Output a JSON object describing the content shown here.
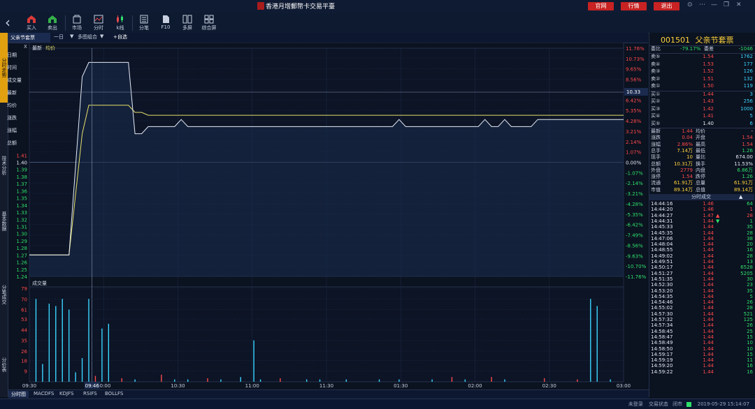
{
  "app": {
    "title": "香港月增郵幣卡交易平臺",
    "top_buttons": [
      "官网",
      "行情",
      "退出"
    ],
    "window_controls": [
      "⊙",
      "⋯",
      "—",
      "❐",
      "✕"
    ]
  },
  "toolbar": {
    "items": [
      {
        "label": "买入",
        "icon": "buy-icon"
      },
      {
        "label": "卖出",
        "icon": "sell-icon"
      },
      {
        "label": "市场",
        "icon": "market-icon"
      },
      {
        "label": "分时",
        "icon": "timeshare-icon"
      },
      {
        "label": "k线",
        "icon": "kline-icon"
      },
      {
        "label": "分笔",
        "icon": "ticks-icon"
      },
      {
        "label": "F10",
        "icon": "f10-icon"
      },
      {
        "label": "多屏",
        "icon": "multiscreen-icon"
      },
      {
        "label": "综合屏",
        "icon": "composite-icon"
      }
    ]
  },
  "left_rail": {
    "tabs": [
      "分时走势",
      "技术分析",
      "基本数据",
      "分笔成交",
      "分价表"
    ]
  },
  "chart_header": {
    "stock": "父亲节套票",
    "period": "一日",
    "period_arrow": "▼",
    "mode": "多图组合",
    "mode_arrow": "▼",
    "add_fav": "+自选",
    "close": "X",
    "legend_latest": "最新",
    "legend_avg": "均价",
    "volume_label": "成交量",
    "crosshair_value": "10.33",
    "crosshair_time": "09:46"
  },
  "overlay_menu": [
    "日期",
    "时间",
    "成交量",
    "最新",
    "均价",
    "涨跌",
    "涨幅",
    "总额"
  ],
  "colors": {
    "price_line": "#e6ebf5",
    "avg_line": "#e8e06a",
    "up": "#ff4a4a",
    "down": "#2ee06a",
    "accent": "#ffd23c",
    "volume_up": "#ff4a4a",
    "volume_down": "#3ad6ff"
  },
  "chart_data": {
    "type": "line",
    "x_ticks": [
      "09:30",
      "10:00",
      "10:30",
      "11:00",
      "11:30",
      "01:30",
      "02:00",
      "02:30",
      "03:00"
    ],
    "y_left_ticks": [
      "1.41",
      "1.40",
      "1.39",
      "1.38",
      "1.37",
      "1.36",
      "1.35",
      "1.34",
      "1.33",
      "1.32",
      "1.31",
      "1.30",
      "1.29",
      "1.28",
      "1.27",
      "1.26",
      "1.25",
      "1.24"
    ],
    "y_right_ticks": [
      "11.76%",
      "10.73%",
      "9.65%",
      "8.56%",
      "7.49%",
      "6.42%",
      "5.35%",
      "4.28%",
      "3.21%",
      "2.14%",
      "1.07%",
      "0.00%",
      "-1.07%",
      "-2.14%",
      "-3.21%",
      "-4.28%",
      "-5.35%",
      "-6.42%",
      "-7.49%",
      "-8.56%",
      "-9.63%",
      "-10.70%",
      "-11.76%"
    ],
    "ylim": [
      1.24,
      1.56
    ],
    "prev_close": 1.4,
    "volume_ticks": [
      "79",
      "70",
      "61",
      "53",
      "44",
      "35",
      "26",
      "18",
      "9"
    ],
    "volume_ylim": [
      0,
      79
    ],
    "series": [
      {
        "name": "最新",
        "points": [
          [
            0,
            1.27
          ],
          [
            6,
            1.27
          ],
          [
            8,
            1.52
          ],
          [
            9,
            1.54
          ],
          [
            15,
            1.54
          ],
          [
            16,
            1.44
          ],
          [
            17,
            1.44
          ],
          [
            18,
            1.45
          ],
          [
            22,
            1.45
          ],
          [
            23,
            1.46
          ],
          [
            24,
            1.45
          ],
          [
            55,
            1.45
          ],
          [
            56,
            1.46
          ],
          [
            57,
            1.45
          ],
          [
            68,
            1.45
          ],
          [
            69,
            1.46
          ],
          [
            70,
            1.45
          ],
          [
            71,
            1.45
          ],
          [
            72,
            1.46
          ],
          [
            73,
            1.45
          ],
          [
            76,
            1.45
          ],
          [
            77,
            1.46
          ],
          [
            90,
            1.46
          ]
        ]
      },
      {
        "name": "均价",
        "points": [
          [
            0,
            1.27
          ],
          [
            6,
            1.27
          ],
          [
            8,
            1.44
          ],
          [
            9,
            1.48
          ],
          [
            15,
            1.48
          ],
          [
            16,
            1.47
          ],
          [
            17,
            1.47
          ],
          [
            18,
            1.466
          ],
          [
            90,
            1.466
          ]
        ]
      }
    ],
    "volume_bars": [
      [
        1,
        70,
        "d"
      ],
      [
        2,
        15,
        "d"
      ],
      [
        3,
        66,
        "d"
      ],
      [
        4,
        64,
        "d"
      ],
      [
        5,
        70,
        "d"
      ],
      [
        6,
        61,
        "d"
      ],
      [
        7,
        8,
        "d"
      ],
      [
        8,
        20,
        "d"
      ],
      [
        9,
        70,
        "d"
      ],
      [
        10,
        5,
        "u"
      ],
      [
        11,
        45,
        "d"
      ],
      [
        12,
        49,
        "d"
      ],
      [
        14,
        3,
        "u"
      ],
      [
        16,
        2,
        "d"
      ],
      [
        20,
        6,
        "u"
      ],
      [
        22,
        2,
        "d"
      ],
      [
        24,
        2,
        "d"
      ],
      [
        27,
        3,
        "u"
      ],
      [
        29,
        2,
        "d"
      ],
      [
        32,
        4,
        "d"
      ],
      [
        34,
        35,
        "d"
      ],
      [
        35,
        2,
        "d"
      ],
      [
        38,
        3,
        "u"
      ],
      [
        42,
        2,
        "d"
      ],
      [
        44,
        2,
        "d"
      ],
      [
        48,
        2,
        "d"
      ],
      [
        53,
        2,
        "d"
      ],
      [
        56,
        2,
        "d"
      ],
      [
        61,
        2,
        "d"
      ],
      [
        64,
        4,
        "u"
      ],
      [
        66,
        2,
        "d"
      ],
      [
        70,
        4,
        "u"
      ],
      [
        72,
        2,
        "d"
      ],
      [
        78,
        3,
        "u"
      ],
      [
        83,
        2,
        "u"
      ],
      [
        85,
        70,
        "d"
      ],
      [
        86,
        64,
        "d"
      ],
      [
        88,
        2,
        "d"
      ]
    ]
  },
  "right_panel": {
    "code": "001501",
    "name": "父亲节套票",
    "ratio_row": {
      "label": "委比",
      "value": "-79.17%",
      "label2": "委差",
      "value2": "-1046"
    },
    "asks": [
      {
        "label": "卖⑤",
        "price": "1.54",
        "vol": "1762"
      },
      {
        "label": "卖④",
        "price": "1.53",
        "vol": "177"
      },
      {
        "label": "卖③",
        "price": "1.52",
        "vol": "126"
      },
      {
        "label": "卖②",
        "price": "1.51",
        "vol": "132"
      },
      {
        "label": "卖①",
        "price": "1.50",
        "vol": "119"
      }
    ],
    "bids": [
      {
        "label": "买①",
        "price": "1.44",
        "vol": "3",
        "pcolor": "r"
      },
      {
        "label": "买②",
        "price": "1.43",
        "vol": "256",
        "pcolor": "r"
      },
      {
        "label": "买③",
        "price": "1.42",
        "vol": "1000",
        "pcolor": "r"
      },
      {
        "label": "买④",
        "price": "1.41",
        "vol": "5",
        "pcolor": "r"
      },
      {
        "label": "买⑤",
        "price": "1.40",
        "vol": "6",
        "pcolor": "w"
      }
    ],
    "stats": [
      {
        "l1": "最新",
        "v1": "1.44",
        "c1": "r",
        "l2": "均价",
        "v2": "-",
        "c2": "w"
      },
      {
        "l1": "涨跌",
        "v1": "0.04",
        "c1": "r",
        "l2": "开盘",
        "v2": "1.54",
        "c2": "r"
      },
      {
        "l1": "涨幅",
        "v1": "2.86%",
        "c1": "r",
        "l2": "最高",
        "v2": "1.54",
        "c2": "r"
      },
      {
        "l1": "总手",
        "v1": "7.14万",
        "c1": "y",
        "l2": "最低",
        "v2": "1.26",
        "c2": "g"
      },
      {
        "l1": "现手",
        "v1": "10",
        "c1": "y",
        "l2": "量比",
        "v2": "674.00",
        "c2": "w"
      },
      {
        "l1": "总额",
        "v1": "10.31万",
        "c1": "y",
        "l2": "换手",
        "v2": "11.53%",
        "c2": "w"
      },
      {
        "l1": "外盘",
        "v1": "2779",
        "c1": "r",
        "l2": "内盘",
        "v2": "6.86万",
        "c2": "g"
      },
      {
        "l1": "涨停",
        "v1": "1.54",
        "c1": "r",
        "l2": "跌停",
        "v2": "1.26",
        "c2": "g"
      },
      {
        "l1": "流通",
        "v1": "61.91万",
        "c1": "y",
        "l2": "总量",
        "v2": "61.91万",
        "c2": "y"
      },
      {
        "l1": "市值",
        "v1": "89.14万",
        "c1": "y",
        "l2": "总值",
        "v2": "89.14万",
        "c2": "y"
      }
    ],
    "ticks_title": "分时成交",
    "ticks_arrow": "▲",
    "ticks": [
      {
        "t": "14:44:16",
        "p": "1.46",
        "a": "",
        "v": "64",
        "vc": "g"
      },
      {
        "t": "14:44:20",
        "p": "1.46",
        "a": "",
        "v": "1",
        "vc": "r"
      },
      {
        "t": "14:44:27",
        "p": "1.47",
        "a": "▲",
        "v": "28",
        "vc": "r"
      },
      {
        "t": "14:44:31",
        "p": "1.44",
        "a": "▼",
        "v": "1",
        "vc": "g"
      },
      {
        "t": "14:45:33",
        "p": "1.44",
        "a": "",
        "v": "35",
        "vc": "g"
      },
      {
        "t": "14:45:35",
        "p": "1.44",
        "a": "",
        "v": "28",
        "vc": "g"
      },
      {
        "t": "14:47:06",
        "p": "1.44",
        "a": "",
        "v": "38",
        "vc": "g"
      },
      {
        "t": "14:48:04",
        "p": "1.44",
        "a": "",
        "v": "20",
        "vc": "g"
      },
      {
        "t": "14:48:55",
        "p": "1.44",
        "a": "",
        "v": "16",
        "vc": "g"
      },
      {
        "t": "14:49:02",
        "p": "1.44",
        "a": "",
        "v": "28",
        "vc": "g"
      },
      {
        "t": "14:49:51",
        "p": "1.44",
        "a": "",
        "v": "13",
        "vc": "g"
      },
      {
        "t": "14:50:17",
        "p": "1.44",
        "a": "",
        "v": "6528",
        "vc": "g"
      },
      {
        "t": "14:51:27",
        "p": "1.44",
        "a": "",
        "v": "5205",
        "vc": "g"
      },
      {
        "t": "14:51:35",
        "p": "1.44",
        "a": "",
        "v": "30",
        "vc": "g"
      },
      {
        "t": "14:52:30",
        "p": "1.44",
        "a": "",
        "v": "23",
        "vc": "g"
      },
      {
        "t": "14:53:20",
        "p": "1.44",
        "a": "",
        "v": "35",
        "vc": "g"
      },
      {
        "t": "14:54:35",
        "p": "1.44",
        "a": "",
        "v": "5",
        "vc": "g"
      },
      {
        "t": "14:54:46",
        "p": "1.44",
        "a": "",
        "v": "26",
        "vc": "g"
      },
      {
        "t": "14:55:02",
        "p": "1.44",
        "a": "",
        "v": "28",
        "vc": "g"
      },
      {
        "t": "14:57:30",
        "p": "1.44",
        "a": "",
        "v": "521",
        "vc": "g"
      },
      {
        "t": "14:57:32",
        "p": "1.44",
        "a": "",
        "v": "125",
        "vc": "g"
      },
      {
        "t": "14:57:34",
        "p": "1.44",
        "a": "",
        "v": "26",
        "vc": "g"
      },
      {
        "t": "14:58:45",
        "p": "1.44",
        "a": "",
        "v": "25",
        "vc": "g"
      },
      {
        "t": "14:58:47",
        "p": "1.44",
        "a": "",
        "v": "15",
        "vc": "g"
      },
      {
        "t": "14:58:49",
        "p": "1.44",
        "a": "",
        "v": "10",
        "vc": "g"
      },
      {
        "t": "14:58:50",
        "p": "1.44",
        "a": "",
        "v": "10",
        "vc": "g"
      },
      {
        "t": "14:59:17",
        "p": "1.44",
        "a": "",
        "v": "15",
        "vc": "g"
      },
      {
        "t": "14:59:19",
        "p": "1.44",
        "a": "",
        "v": "11",
        "vc": "g"
      },
      {
        "t": "14:59:20",
        "p": "1.44",
        "a": "",
        "v": "16",
        "vc": "g"
      },
      {
        "t": "14:59:22",
        "p": "1.44",
        "a": "",
        "v": "16",
        "vc": "g"
      }
    ]
  },
  "bottom_tabs": [
    "分时图",
    "MACDFS",
    "KDJFS",
    "RSIFS",
    "BOLLFS"
  ],
  "status": {
    "left_text": "未登录",
    "conn_label": "交易状态",
    "conn_value": "闭市",
    "datetime": "2019-05-29 15:14:07"
  }
}
